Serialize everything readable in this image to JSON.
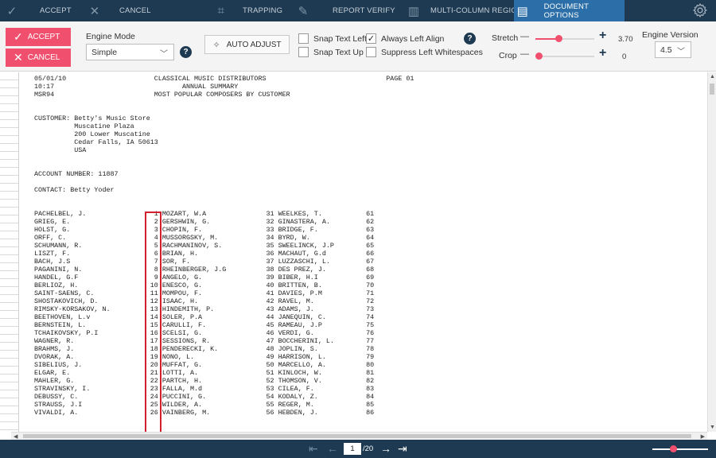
{
  "toolbar": {
    "accept": "ACCEPT",
    "cancel": "CANCEL",
    "trapping": "TRAPPING",
    "report_verify": "REPORT VERIFY",
    "multi_column": "MULTI-COLUMN REGION",
    "document_options": "DOCUMENT OPTIONS"
  },
  "ribbon": {
    "accept_label": "ACCEPT",
    "cancel_label": "CANCEL",
    "engine_mode_label": "Engine Mode",
    "engine_mode_value": "Simple",
    "auto_adjust": "AUTO ADJUST",
    "snap_text_left": "Snap Text Left",
    "snap_text_up": "Snap Text Up",
    "always_left_align": "Always Left Align",
    "suppress_left_whitespaces": "Suppress Left Whitespaces",
    "stretch_label": "Stretch",
    "stretch_value": "3.70",
    "crop_label": "Crop",
    "crop_value": "0",
    "engine_version_label": "Engine Version",
    "engine_version_value": "4.5",
    "colors": {
      "accent": "#f0506e",
      "dark": "#1e3a52",
      "active": "#2c6fa8"
    }
  },
  "document": {
    "lines": [
      "05/01/10                      CLASSICAL MUSIC DISTRIBUTORS                              PAGE 01",
      "10:17                                ANNUAL SUMMARY",
      "MSR94                         MOST POPULAR COMPOSERS BY CUSTOMER",
      "",
      "",
      "CUSTOMER: Betty's Music Store",
      "          Muscatine Plaza",
      "          200 Lower Muscatine",
      "          Cedar Falls, IA 50613",
      "          USA",
      "",
      "",
      "ACCOUNT NUMBER: 11887",
      "",
      "CONTACT: Betty Yoder",
      "",
      "",
      "PACHELBEL, J.                 1 MOZART, W.A               31 WEELKES, T.           61",
      "GRIEG, E.                     2 GERSHWIN, G.              32 GINASTERA, A.         62",
      "HOLST, G.                     3 CHOPIN, F.                33 BRIDGE, F.            63",
      "ORFF, C.                      4 MUSSORGSKY, M.            34 BYRD, W.              64",
      "SCHUMANN, R.                  5 RACHMANINOV, S.           35 SWEELINCK, J.P        65",
      "LISZT, F.                     6 BRIAN, H.                 36 MACHAUT, G.d          66",
      "BACH, J.S                     7 SOR, F.                   37 LUZZASCHI, L.         67",
      "PAGANINI, N.                  8 RHEINBERGER, J.G          38 DES PREZ, J.          68",
      "HANDEL, G.F                   9 ANGELO, G.                39 BIBER, H.I            69",
      "BERLIOZ, H.                  10 ENESCO, G.                40 BRITTEN, B.           70",
      "SAINT-SAENS, C.              11 MOMPOU, F.                41 DAVIES, P.M           71",
      "SHOSTAKOVICH, D.             12 ISAAC, H.                 42 RAVEL, M.             72",
      "RIMSKY-KORSAKOV, N.          13 HINDEMITH, P.             43 ADAMS, J.             73",
      "BEETHOVEN, L.v               14 SOLER, P.A                44 JANEQUIN, C.          74",
      "BERNSTEIN, L.                15 CARULLI, F.               45 RAMEAU, J.P           75",
      "TCHAIKOVSKY, P.I             16 SCELSI, G.                46 VERDI, G.             76",
      "WAGNER, R.                   17 SESSIONS, R.              47 BOCCHERINI, L.        77",
      "BRAHMS, J.                   18 PENDERECKI, K.            48 JOPLIN, S.            78",
      "DVORAK, A.                   19 NONO, L.                  49 HARRISON, L.          79",
      "SIBELIUS, J.                 20 MUFFAT, G.                50 MARCELLO, A.          80",
      "ELGAR, E.                    21 LOTTI, A.                 51 KINLOCH, W.           81",
      "MAHLER, G.                   22 PARTCH, H.                52 THOMSON, V.           82",
      "STRAVINSKY, I.               23 FALLA, M.d                53 CILEA, F.             83",
      "DEBUSSY, C.                  24 PUCCINI, G.               54 KODALY, Z.            84",
      "STRAUSS, J.I                 25 WILDER, A.                55 REGER, M.             85",
      "VIVALDI, A.                  26 VAINBERG, M.              56 HEBDEN, J.            86"
    ]
  },
  "footer": {
    "current_page": "1",
    "total_pages": "/20"
  }
}
